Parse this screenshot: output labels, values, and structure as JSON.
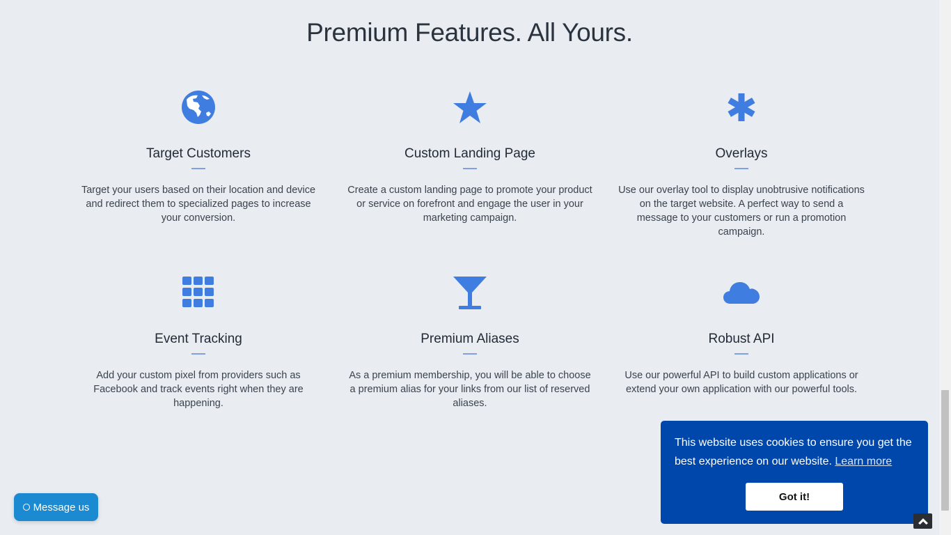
{
  "section": {
    "title": "Premium Features. All Yours."
  },
  "features": [
    {
      "icon": "globe-icon",
      "title": "Target Customers",
      "description": "Target your users based on their location and device and redirect them to specialized pages to increase your conversion."
    },
    {
      "icon": "star-icon",
      "title": "Custom Landing Page",
      "description": "Create a custom landing page to promote your product or service on forefront and engage the user in your marketing campaign."
    },
    {
      "icon": "asterisk-icon",
      "title": "Overlays",
      "description": "Use our overlay tool to display unobtrusive notifications on the target website. A perfect way to send a message to your customers or run a promotion campaign."
    },
    {
      "icon": "grid-icon",
      "title": "Event Tracking",
      "description": "Add your custom pixel from providers such as Facebook and track events right when they are happening."
    },
    {
      "icon": "glass-icon",
      "title": "Premium Aliases",
      "description": "As a premium membership, you will be able to choose a premium alias for your links from our list of reserved aliases."
    },
    {
      "icon": "cloud-icon",
      "title": "Robust API",
      "description": "Use our powerful API to build custom applications or extend your own application with our powerful tools."
    }
  ],
  "cookie": {
    "message": "This website uses cookies to ensure you get the best experience on our website.",
    "learn_more": "Learn more",
    "button": "Got it!"
  },
  "chat": {
    "label": "Message us"
  },
  "colors": {
    "accent": "#3f7ee0",
    "cookie_bg": "#0047ab",
    "chat_bg": "#1b8ad0",
    "background": "#e9ecf1"
  }
}
